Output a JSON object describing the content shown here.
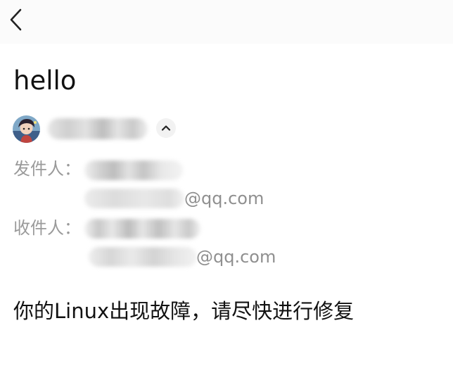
{
  "header": {
    "back_icon": "chevron-left-icon"
  },
  "mail": {
    "subject": "hello",
    "sender_avatar": "anime-avatar",
    "expand_icon": "chevron-up-icon",
    "from_label": "发件人：",
    "to_label": "收件人：",
    "from_email_domain": "@qq.com",
    "to_email_domain": "@qq.com",
    "body": "你的Linux出现故障，请尽快进行修复"
  }
}
